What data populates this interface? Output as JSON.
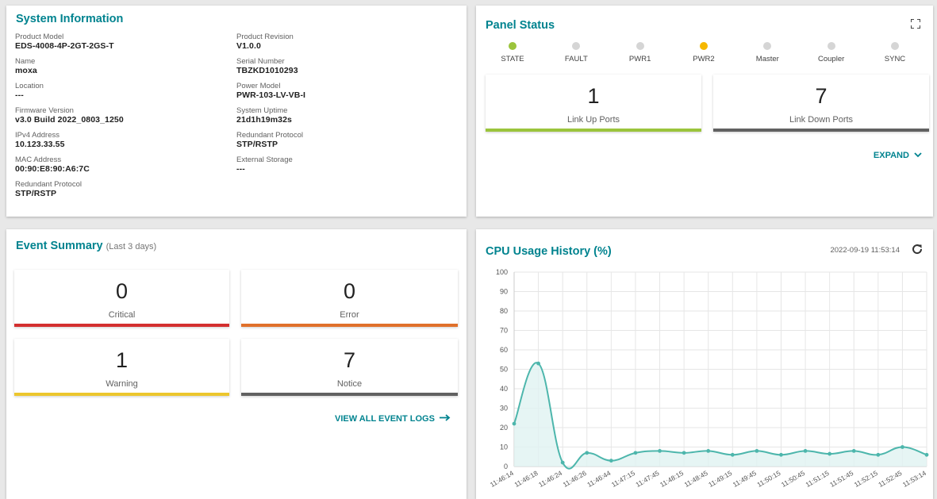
{
  "system": {
    "title": "System Information",
    "left": [
      {
        "label": "Product Model",
        "value": "EDS-4008-4P-2GT-2GS-T"
      },
      {
        "label": "Name",
        "value": "moxa"
      },
      {
        "label": "Location",
        "value": "---"
      },
      {
        "label": "Firmware Version",
        "value": "v3.0 Build 2022_0803_1250"
      },
      {
        "label": "IPv4 Address",
        "value": "10.123.33.55"
      },
      {
        "label": "MAC Address",
        "value": "00:90:E8:90:A6:7C"
      },
      {
        "label": "Redundant Protocol",
        "value": "STP/RSTP"
      }
    ],
    "right": [
      {
        "label": "Product Revision",
        "value": "V1.0.0"
      },
      {
        "label": "Serial Number",
        "value": "TBZKD1010293"
      },
      {
        "label": "Power Model",
        "value": "PWR-103-LV-VB-I"
      },
      {
        "label": "System Uptime",
        "value": "21d1h19m32s"
      },
      {
        "label": "Redundant Protocol",
        "value": "STP/RSTP"
      },
      {
        "label": "External Storage",
        "value": "---"
      }
    ]
  },
  "panel": {
    "title": "Panel Status",
    "leds": [
      {
        "label": "STATE",
        "color": "#9bc43c"
      },
      {
        "label": "FAULT",
        "color": "#d5d5d5"
      },
      {
        "label": "PWR1",
        "color": "#d5d5d5"
      },
      {
        "label": "PWR2",
        "color": "#f6b800"
      },
      {
        "label": "Master",
        "color": "#d5d5d5"
      },
      {
        "label": "Coupler",
        "color": "#d5d5d5"
      },
      {
        "label": "SYNC",
        "color": "#d5d5d5"
      }
    ],
    "link_up": {
      "count": "1",
      "label": "Link Up Ports",
      "color": "#9bc43c"
    },
    "link_down": {
      "count": "7",
      "label": "Link Down Ports",
      "color": "#616161"
    },
    "expand_label": "EXPAND"
  },
  "events": {
    "title": "Event Summary",
    "subtitle": "(Last 3 days)",
    "critical": {
      "count": "0",
      "label": "Critical",
      "color": "#d32f2f"
    },
    "error": {
      "count": "0",
      "label": "Error",
      "color": "#e0702a"
    },
    "warning": {
      "count": "1",
      "label": "Warning",
      "color": "#ecc62e"
    },
    "notice": {
      "count": "7",
      "label": "Notice",
      "color": "#616161"
    },
    "view_all_label": "VIEW ALL EVENT LOGS"
  },
  "cpu": {
    "title": "CPU Usage History (%)",
    "timestamp": "2022-09-19 11:53:14"
  },
  "chart_data": {
    "type": "area",
    "x": [
      "11:46:14",
      "11:46:18",
      "11:46:24",
      "11:46:26",
      "11:46:44",
      "11:47:15",
      "11:47:45",
      "11:48:15",
      "11:48:45",
      "11:49:15",
      "11:49:45",
      "11:50:15",
      "11:50:45",
      "11:51:15",
      "11:51:45",
      "11:52:15",
      "11:52:45",
      "11:53:14"
    ],
    "series": [
      {
        "values": [
          22,
          53,
          2,
          7,
          3,
          7,
          8,
          7,
          8,
          6,
          8,
          6,
          8,
          6.5,
          8,
          6,
          10,
          6
        ]
      }
    ],
    "ylim": [
      0,
      100
    ],
    "yticks": [
      0,
      10,
      20,
      30,
      40,
      50,
      60,
      70,
      80,
      90,
      100
    ],
    "grid": true,
    "colors": {
      "line": "#4db6ac",
      "fill": "#e0f2f1"
    }
  }
}
